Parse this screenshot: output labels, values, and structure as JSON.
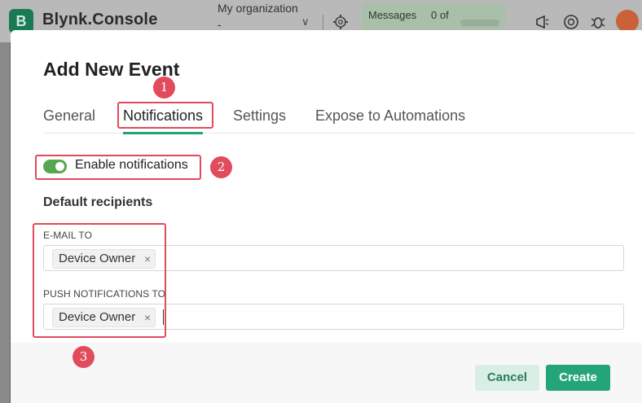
{
  "app": {
    "logo_letter": "B",
    "name": "Blynk.Console",
    "organization": "My organization -",
    "messages_label": "Messages",
    "messages_count": "0 of"
  },
  "modal": {
    "title": "Add New Event",
    "tabs": [
      {
        "label": "General",
        "active": false
      },
      {
        "label": "Notifications",
        "active": true
      },
      {
        "label": "Settings",
        "active": false
      },
      {
        "label": "Expose to Automations",
        "active": false
      }
    ],
    "enable_notifications": {
      "label": "Enable notifications",
      "on": true
    },
    "section_title": "Default recipients",
    "email_to": {
      "label": "E-MAIL TO",
      "chips": [
        "Device Owner"
      ]
    },
    "push_to": {
      "label": "PUSH NOTIFICATIONS TO",
      "chips": [
        "Device Owner"
      ]
    },
    "chip_remove_glyph": "×",
    "buttons": {
      "cancel": "Cancel",
      "create": "Create"
    }
  },
  "annotations": {
    "markers": [
      "1",
      "2",
      "3"
    ]
  },
  "colors": {
    "accent": "#23a37a",
    "toggle_on": "#57a74f",
    "annotation": "#e14b5b",
    "create_bg": "#24a479",
    "cancel_bg": "#d9efe5"
  }
}
